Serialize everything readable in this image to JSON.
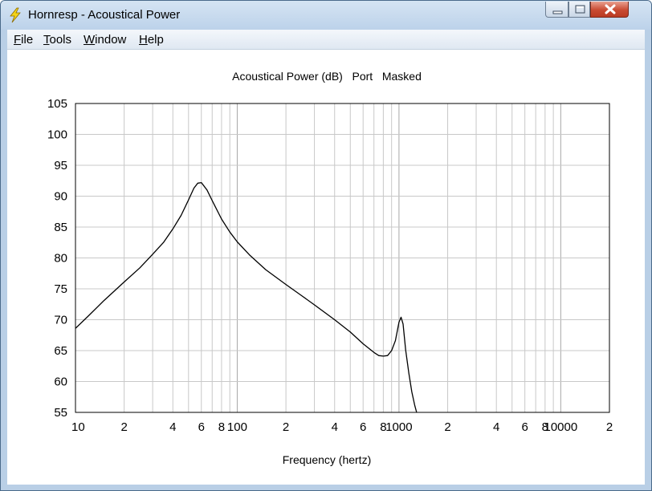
{
  "window": {
    "title": "Hornresp - Acoustical Power",
    "app_icon": "lightning-bolt-icon",
    "controls": [
      "minimize-icon",
      "maximize-icon",
      "close-icon"
    ]
  },
  "menu": [
    {
      "label": "File",
      "accel": "F",
      "rest": "ile"
    },
    {
      "label": "Tools",
      "accel": "T",
      "rest": "ools"
    },
    {
      "label": "Window",
      "accel": "W",
      "rest": "indow"
    },
    {
      "label": "Help",
      "accel": "H",
      "rest": "elp"
    }
  ],
  "chart_data": {
    "type": "line",
    "title": "Acoustical Power (dB)   Port   Masked",
    "xlabel": "Frequency (hertz)",
    "ylabel": "",
    "x_scale": "log",
    "xlim": [
      10,
      20000
    ],
    "ylim": [
      55,
      105
    ],
    "y_ticks": [
      55,
      60,
      65,
      70,
      75,
      80,
      85,
      90,
      95,
      100,
      105
    ],
    "x_tick_labels": [
      {
        "x": 10,
        "label": "10"
      },
      {
        "x": 20,
        "label": "2"
      },
      {
        "x": 40,
        "label": "4"
      },
      {
        "x": 60,
        "label": "6"
      },
      {
        "x": 80,
        "label": "8"
      },
      {
        "x": 100,
        "label": "100"
      },
      {
        "x": 200,
        "label": "2"
      },
      {
        "x": 400,
        "label": "4"
      },
      {
        "x": 600,
        "label": "6"
      },
      {
        "x": 800,
        "label": "8"
      },
      {
        "x": 1000,
        "label": "1000"
      },
      {
        "x": 2000,
        "label": "2"
      },
      {
        "x": 4000,
        "label": "4"
      },
      {
        "x": 6000,
        "label": "6"
      },
      {
        "x": 8000,
        "label": "8"
      },
      {
        "x": 10000,
        "label": "10000"
      },
      {
        "x": 20000,
        "label": "2"
      }
    ],
    "grid": true,
    "line_color": "#000000",
    "grid_color": "#c8c8c8",
    "series": [
      {
        "x": [
          10,
          12,
          15,
          20,
          25,
          30,
          35,
          40,
          45,
          50,
          54,
          57,
          60,
          65,
          70,
          80,
          90,
          100,
          120,
          150,
          200,
          250,
          300,
          400,
          500,
          600,
          700,
          750,
          800,
          850,
          900,
          950,
          1000,
          1030,
          1060,
          1100,
          1150,
          1200,
          1250,
          1300
        ],
        "y": [
          68.6,
          70.6,
          73.1,
          76.1,
          78.4,
          80.6,
          82.5,
          84.7,
          86.9,
          89.4,
          91.3,
          92.1,
          92.2,
          91.0,
          89.3,
          86.3,
          84.2,
          82.6,
          80.4,
          78.1,
          75.7,
          73.9,
          72.4,
          70.0,
          68.0,
          66.1,
          64.7,
          64.2,
          64.1,
          64.2,
          65.0,
          66.6,
          69.6,
          70.4,
          69.3,
          65.1,
          61.4,
          58.3,
          56.2,
          54.5
        ]
      }
    ]
  }
}
